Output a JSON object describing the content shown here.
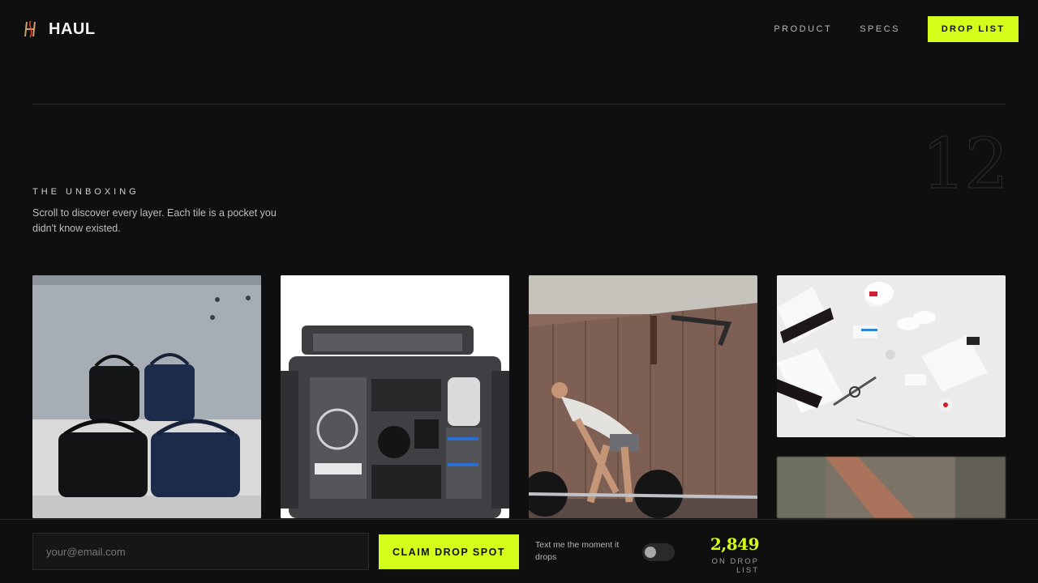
{
  "brand": {
    "name": "HAUL",
    "logo_icon": "monogram-logo-icon",
    "accent": "#d4ff1a"
  },
  "nav": {
    "items": [
      "PRODUCT",
      "SPECS"
    ],
    "cta": "DROP LIST"
  },
  "hero": {
    "number": "12"
  },
  "section": {
    "label": "THE UNBOXING",
    "description": "Scroll to discover every layer. Each tile is a pocket you didn't know existed."
  },
  "tiles": [
    {
      "image": "duffel-bags-photo"
    },
    {
      "image": "open-camera-bag-photo"
    },
    {
      "image": "deadlift-athlete-photo"
    },
    {
      "image": "flatlay-gear-photo"
    },
    {
      "image": "blurred-leather-strap-photo"
    }
  ],
  "signup": {
    "email_placeholder": "your@email.com",
    "email_value": "",
    "claim_label": "CLAIM DROP SPOT",
    "sms_label": "Text me the moment it drops",
    "sms_enabled": false,
    "count": "2,849",
    "count_label": "ON DROP LIST"
  }
}
